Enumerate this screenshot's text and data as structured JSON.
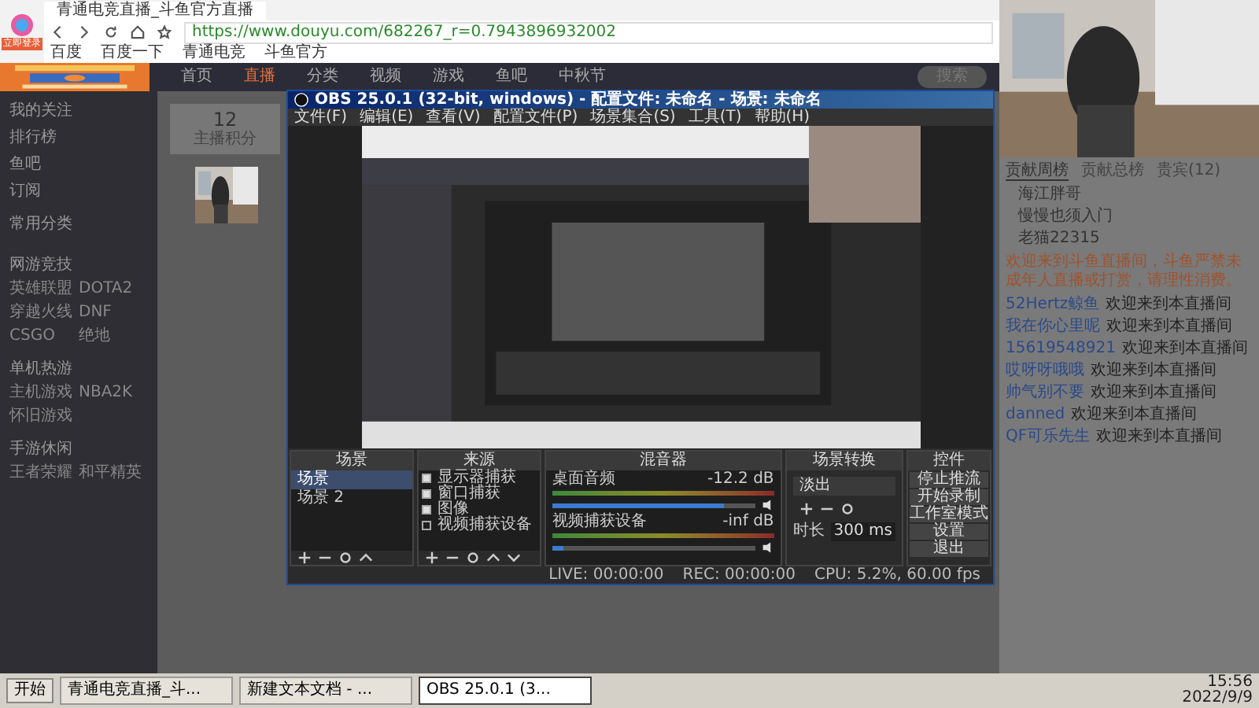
{
  "browser": {
    "badge": "立即登录",
    "tab": {
      "title": "青通电竞直播_斗鱼官方直播"
    },
    "url": "https://www.douyu.com/682267_r=0.7943896932002",
    "bookmarks": [
      "百度",
      "百度一下",
      "青通电竞",
      "斗鱼官方"
    ]
  },
  "site": {
    "nav": [
      {
        "label": "首页",
        "selected": false
      },
      {
        "label": "直播",
        "selected": true
      },
      {
        "label": "分类",
        "selected": false
      },
      {
        "label": "视频",
        "selected": false
      },
      {
        "label": "游戏",
        "selected": false
      },
      {
        "label": "鱼吧",
        "selected": false
      },
      {
        "label": "中秋节",
        "selected": false
      }
    ],
    "search": {
      "placeholder": "搜索"
    },
    "sidebar": {
      "links": [
        "我的关注",
        "排行榜",
        "鱼吧",
        "订阅"
      ],
      "sections": [
        {
          "title": "常用分类"
        },
        {
          "title": "网游竞技",
          "items": [
            "英雄联盟",
            "DOTA2",
            "穿越火线",
            "DNF",
            "CSGO",
            "绝地"
          ]
        },
        {
          "title": "单机热游",
          "items": [
            "主机游戏",
            "NBA2K",
            "怀旧游戏"
          ]
        },
        {
          "title": "手游休闲",
          "items": [
            "王者荣耀",
            "和平精英"
          ]
        }
      ]
    },
    "stat": {
      "value": "12",
      "label": "主播积分"
    }
  },
  "obs": {
    "title": "OBS 25.0.1 (32-bit, windows) - 配置文件: 未命名 - 场景: 未命名",
    "menu": [
      "文件(F)",
      "编辑(E)",
      "查看(V)",
      "配置文件(P)",
      "场景集合(S)",
      "工具(T)",
      "帮助(H)"
    ],
    "docks": [
      "场景",
      "来源",
      "混音器",
      "场景转换",
      "控件"
    ],
    "scenes": [
      {
        "name": "场景",
        "selected": true
      },
      {
        "name": "场景 2",
        "selected": false
      }
    ],
    "sources": [
      {
        "name": "显示器捕获",
        "visible": true
      },
      {
        "name": "窗口捕获",
        "visible": true
      },
      {
        "name": "图像",
        "visible": true
      },
      {
        "name": "视频捕获设备",
        "visible": false
      }
    ],
    "mixer": [
      {
        "name": "桌面音频",
        "reading": "-12.2 dB",
        "level": 0.85
      },
      {
        "name": "视频捕获设备",
        "reading": "-inf dB",
        "level": 0.05
      }
    ],
    "transition": {
      "value": "淡出",
      "duration_label": "时长",
      "duration": "300 ms"
    },
    "controls": [
      "停止推流",
      "开始录制",
      "工作室模式",
      "设置",
      "退出"
    ],
    "status": [
      "LIVE: 00:00:00",
      "REC: 00:00:00",
      "CPU: 5.2%, 60.00 fps"
    ]
  },
  "chat": {
    "tabs": [
      {
        "label": "贡献周榜",
        "selected": true
      },
      {
        "label": "贡献总榜",
        "selected": false
      },
      {
        "label": "贵宾(12)",
        "selected": false
      }
    ],
    "ranking": [
      "海江胖哥",
      "慢慢也须入门",
      "老猫22315"
    ],
    "notice": "欢迎来到斗鱼直播间，斗鱼严禁未成年人直播或打赏，请理性消费。",
    "messages": [
      {
        "user": "52Hertz鲸鱼",
        "text": "欢迎来到本直播间"
      },
      {
        "user": "我在你心里呢",
        "text": "欢迎来到本直播间"
      },
      {
        "user": "15619548921",
        "text": "欢迎来到本直播间"
      },
      {
        "user": "哎呀呀哦哦",
        "text": "欢迎来到本直播间"
      },
      {
        "user": "帅气别不要",
        "text": "欢迎来到本直播间"
      },
      {
        "user": "danned",
        "text": "欢迎来到本直播间"
      },
      {
        "user": "QF可乐先生",
        "text": "欢迎来到本直播间"
      }
    ]
  },
  "taskbar": {
    "start": "开始",
    "windows": [
      {
        "title": "青通电竞直播_斗...",
        "selected": false
      },
      {
        "title": "新建文本文档 - ...",
        "selected": false
      },
      {
        "title": "OBS 25.0.1 (3...",
        "selected": true
      }
    ],
    "time": "15:56",
    "date": "2022/9/9"
  }
}
